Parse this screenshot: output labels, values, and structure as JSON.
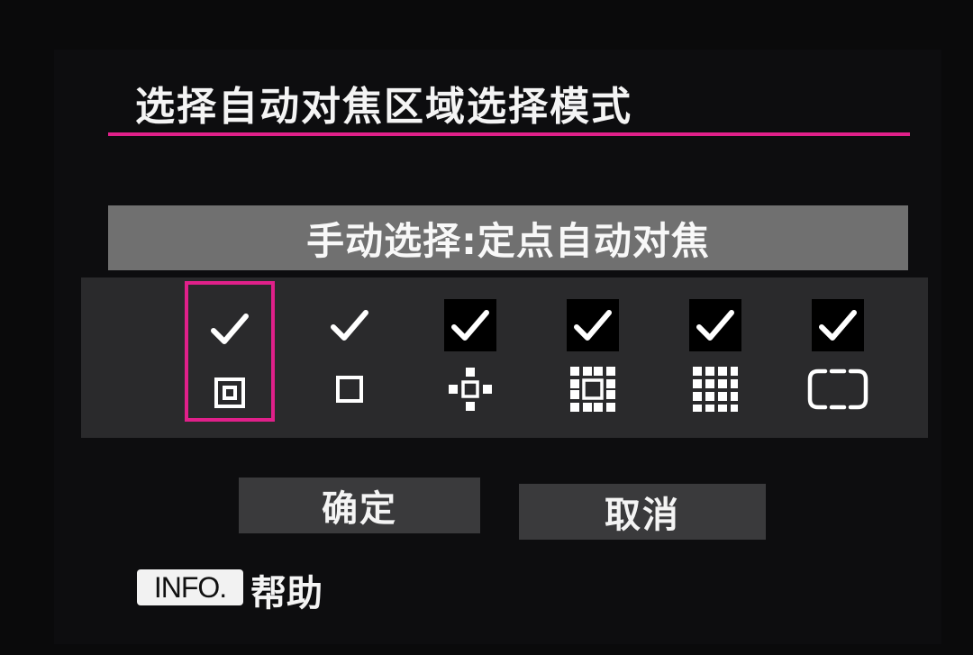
{
  "header": {
    "title": "选择自动对焦区域选择模式"
  },
  "mode": {
    "label": "手动选择:定点自动对焦"
  },
  "options": [
    {
      "icon": "spot-af-icon",
      "checked": true,
      "selected": true
    },
    {
      "icon": "single-point-af-icon",
      "checked": true,
      "selected": false
    },
    {
      "icon": "expand-area-cross-icon",
      "checked": true,
      "selected": false
    },
    {
      "icon": "expand-area-surround-icon",
      "checked": true,
      "selected": false
    },
    {
      "icon": "zone-af-icon",
      "checked": true,
      "selected": false
    },
    {
      "icon": "auto-selection-af-icon",
      "checked": true,
      "selected": false
    }
  ],
  "buttons": {
    "ok_label": "确定",
    "cancel_label": "取消"
  },
  "footer": {
    "info_badge": "INFO.",
    "help_label": "帮助"
  },
  "colors": {
    "accent": "#e0208a",
    "bar": "#707070",
    "row": "#2a2a2c",
    "button": "#3a3a3c"
  }
}
